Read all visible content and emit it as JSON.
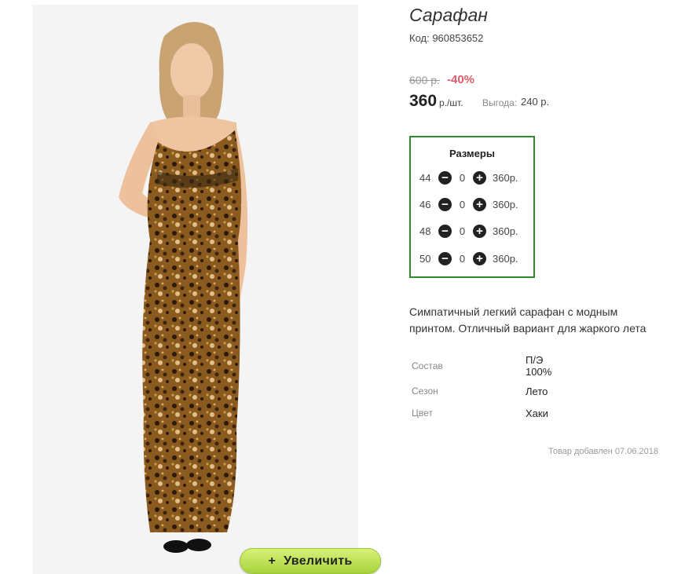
{
  "product": {
    "title": "Сарафан",
    "code": "Код: 960853652",
    "old_price": "600 р.",
    "discount": "-40%",
    "price": "360",
    "price_unit": "р./шт.",
    "benefit_label": "Выгода:",
    "benefit_value": "240 р."
  },
  "sizes": {
    "title": "Размеры",
    "rows": [
      {
        "size": "44",
        "qty": "0",
        "price": "360р."
      },
      {
        "size": "46",
        "qty": "0",
        "price": "360р."
      },
      {
        "size": "48",
        "qty": "0",
        "price": "360р."
      },
      {
        "size": "50",
        "qty": "0",
        "price": "360р."
      }
    ]
  },
  "description": "Симпатичный легкий сарафан с модным принтом. Отличный вариант для жаркого лета",
  "properties": [
    {
      "label": "Состав",
      "value_line1": "П/Э",
      "value_line2": "100%"
    },
    {
      "label": "Сезон",
      "value_line1": "Лето",
      "value_line2": ""
    },
    {
      "label": "Цвет",
      "value_line1": "Хаки",
      "value_line2": ""
    }
  ],
  "added": "Товар добавлен 07.06.2018",
  "zoom_button": {
    "icon": "+",
    "label": "Увеличить"
  },
  "colors": {
    "sizes_border": "#2e8b2e",
    "discount": "#e05a6a",
    "zoom_button": "#b8dd50"
  }
}
